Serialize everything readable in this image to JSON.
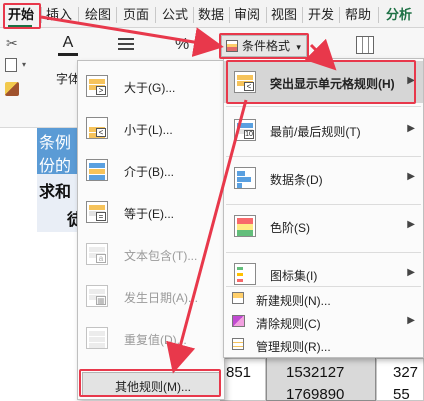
{
  "ribbon_tabs": [
    "开始",
    "插入",
    "绘图",
    "页面",
    "公式",
    "数据",
    "审阅",
    "视图",
    "开发",
    "帮助",
    "分析"
  ],
  "ribbon": {
    "font_label": "字体",
    "cf_button_label": "条件格式",
    "cf_button_caret": "▾"
  },
  "sheet": {
    "rows": [
      {
        "a": "条例",
        "b": ""
      },
      {
        "a": "份的",
        "b": ""
      },
      {
        "a": "求和",
        "b": ""
      },
      {
        "a": "徒",
        "b": ""
      }
    ],
    "numbers": [
      "851",
      "1532127",
      "327",
      "1769890",
      "55"
    ]
  },
  "menu_left": {
    "items": [
      {
        "label": "大于(G)...",
        "enabled": true
      },
      {
        "label": "小于(L)...",
        "enabled": true
      },
      {
        "label": "介于(B)...",
        "enabled": true
      },
      {
        "label": "等于(E)...",
        "enabled": true
      },
      {
        "label": "文本包含(T)...",
        "enabled": false
      },
      {
        "label": "发生日期(A)...",
        "enabled": false
      },
      {
        "label": "重复值(D)...",
        "enabled": false
      }
    ],
    "other_rules": "其他规则(M)..."
  },
  "menu_right": {
    "items": [
      {
        "label": "突出显示单元格规则(H)",
        "submenu": true
      },
      {
        "label": "最前/最后规则(T)",
        "submenu": true
      },
      {
        "label": "数据条(D)",
        "submenu": true
      },
      {
        "label": "色阶(S)",
        "submenu": true
      },
      {
        "label": "图标集(I)",
        "submenu": true
      }
    ],
    "small_items": [
      {
        "label": "新建规则(N)...",
        "submenu": false
      },
      {
        "label": "清除规则(C)",
        "submenu": true
      },
      {
        "label": "管理规则(R)...",
        "submenu": false
      }
    ],
    "submenu_arrow": "▶"
  },
  "colors": {
    "annotation_red": "#e8384b",
    "excel_green": "#1e7145",
    "header_blue": "#5b9bd5"
  }
}
